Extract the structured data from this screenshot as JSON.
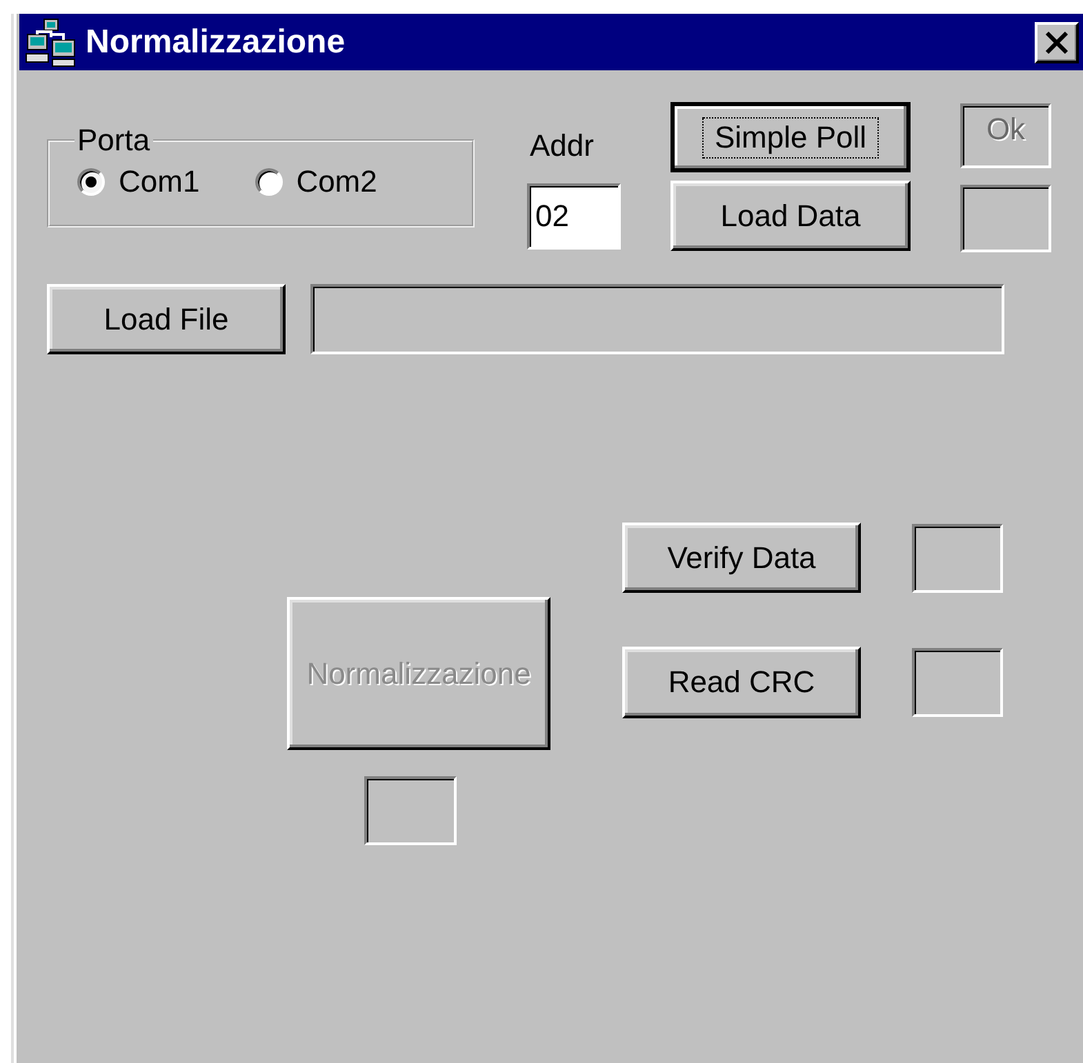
{
  "window": {
    "title": "Normalizzazione"
  },
  "port_group": {
    "label": "Porta",
    "options": [
      {
        "label": "Com1",
        "selected": true
      },
      {
        "label": "Com2",
        "selected": false
      }
    ]
  },
  "address": {
    "label": "Addr",
    "value": "02"
  },
  "simple_poll": {
    "label": "Simple Poll",
    "focused": true,
    "disabled": false
  },
  "ok_indicator": {
    "text": "Ok",
    "disabled": true
  },
  "load_data": {
    "label": "Load Data",
    "focused": false,
    "disabled": false
  },
  "load_file": {
    "label": "Load File",
    "focused": false,
    "disabled": false
  },
  "verify_data": {
    "label": "Verify Data",
    "focused": false,
    "disabled": false
  },
  "read_crc": {
    "label": "Read CRC",
    "focused": false,
    "disabled": false
  },
  "normalize": {
    "label": "Normalizzazione",
    "focused": false,
    "disabled": true
  }
}
